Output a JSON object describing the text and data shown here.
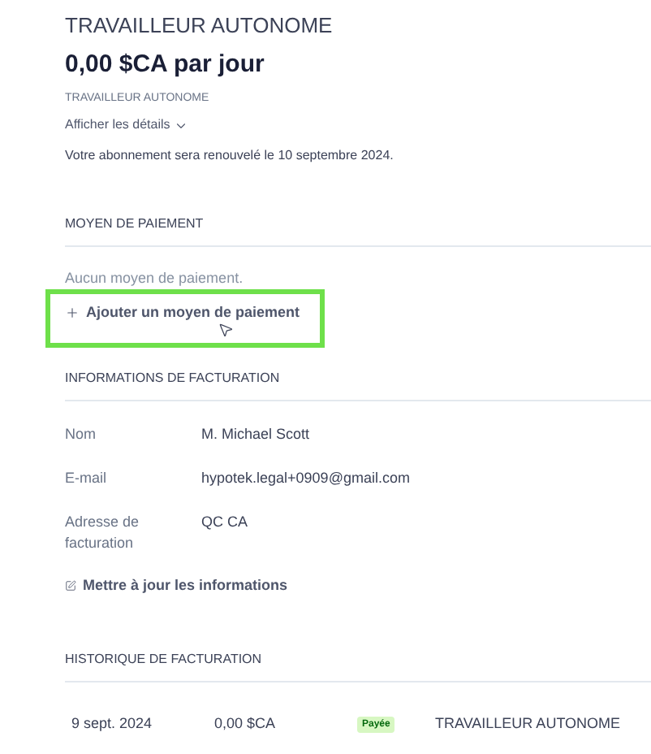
{
  "plan": {
    "title": "TRAVAILLEUR AUTONOME",
    "price": "0,00 $CA par jour",
    "subtitle": "TRAVAILLEUR AUTONOME",
    "details_link": "Afficher les détails",
    "renewal": "Votre abonnement sera renouvelé le 10 septembre 2024."
  },
  "payment": {
    "heading": "MOYEN DE PAIEMENT",
    "empty": "Aucun moyen de paiement.",
    "add_link": "Ajouter un moyen de paiement",
    "highlighted": true
  },
  "billing": {
    "heading": "INFORMATIONS DE FACTURATION",
    "fields": [
      {
        "label": "Nom",
        "value": "M. Michael Scott"
      },
      {
        "label": "E-mail",
        "value": "hypotek.legal+0909@gmail.com"
      },
      {
        "label": "Adresse de facturation",
        "value": "QC CA"
      }
    ],
    "update_link": "Mettre à jour les informations"
  },
  "history": {
    "heading": "HISTORIQUE DE FACTURATION",
    "rows": [
      {
        "date": "9 sept. 2024",
        "amount": "0,00 $CA",
        "status": "Payée",
        "plan": "TRAVAILLEUR AUTONOME"
      }
    ]
  }
}
